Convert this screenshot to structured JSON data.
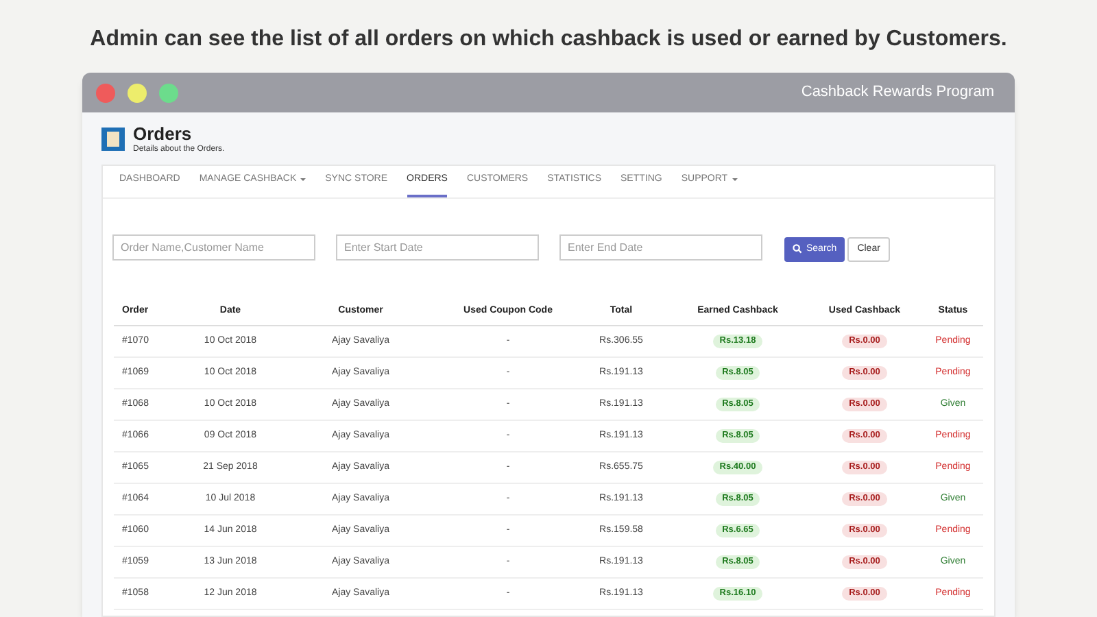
{
  "caption": "Admin can see the list of all orders on which cashback is used or earned by Customers.",
  "window": {
    "title": "Cashback Rewards Program"
  },
  "page": {
    "title": "Orders",
    "subtitle": "Details about the Orders."
  },
  "tabs": [
    {
      "label": "DASHBOARD",
      "selected": false,
      "has_menu": false
    },
    {
      "label": "MANAGE CASHBACK",
      "selected": false,
      "has_menu": true
    },
    {
      "label": "SYNC STORE",
      "selected": false,
      "has_menu": false
    },
    {
      "label": "ORDERS",
      "selected": true,
      "has_menu": false
    },
    {
      "label": "CUSTOMERS",
      "selected": false,
      "has_menu": false
    },
    {
      "label": "STATISTICS",
      "selected": false,
      "has_menu": false
    },
    {
      "label": "SETTING",
      "selected": false,
      "has_menu": false
    },
    {
      "label": "SUPPORT",
      "selected": false,
      "has_menu": true
    }
  ],
  "filters": [
    {
      "placeholder": "Order Name,Customer Name"
    },
    {
      "placeholder": "Enter Start Date"
    },
    {
      "placeholder": "Enter End Date"
    }
  ],
  "buttons": {
    "search": "Search",
    "clear": "Clear"
  },
  "table": {
    "columns": [
      "Order",
      "Date",
      "Customer",
      "Used Coupon Code",
      "Total",
      "Earned Cashback",
      "Used Cashback",
      "Status"
    ],
    "rows": [
      {
        "order": "#1070",
        "date": "10 Oct 2018",
        "customer": "Ajay Savaliya",
        "coupon": "-",
        "total": "Rs.306.55",
        "earned": "Rs.13.18",
        "used": "Rs.0.00",
        "status": "Pending",
        "kind": "pending"
      },
      {
        "order": "#1069",
        "date": "10 Oct 2018",
        "customer": "Ajay Savaliya",
        "coupon": "-",
        "total": "Rs.191.13",
        "earned": "Rs.8.05",
        "used": "Rs.0.00",
        "status": "Pending",
        "kind": "pending"
      },
      {
        "order": "#1068",
        "date": "10 Oct 2018",
        "customer": "Ajay Savaliya",
        "coupon": "-",
        "total": "Rs.191.13",
        "earned": "Rs.8.05",
        "used": "Rs.0.00",
        "status": "Given",
        "kind": "given"
      },
      {
        "order": "#1066",
        "date": "09 Oct 2018",
        "customer": "Ajay Savaliya",
        "coupon": "-",
        "total": "Rs.191.13",
        "earned": "Rs.8.05",
        "used": "Rs.0.00",
        "status": "Pending",
        "kind": "pending"
      },
      {
        "order": "#1065",
        "date": "21 Sep 2018",
        "customer": "Ajay Savaliya",
        "coupon": "-",
        "total": "Rs.655.75",
        "earned": "Rs.40.00",
        "used": "Rs.0.00",
        "status": "Pending",
        "kind": "pending"
      },
      {
        "order": "#1064",
        "date": "10 Jul 2018",
        "customer": "Ajay Savaliya",
        "coupon": "-",
        "total": "Rs.191.13",
        "earned": "Rs.8.05",
        "used": "Rs.0.00",
        "status": "Given",
        "kind": "given"
      },
      {
        "order": "#1060",
        "date": "14 Jun 2018",
        "customer": "Ajay Savaliya",
        "coupon": "-",
        "total": "Rs.159.58",
        "earned": "Rs.6.65",
        "used": "Rs.0.00",
        "status": "Pending",
        "kind": "pending"
      },
      {
        "order": "#1059",
        "date": "13 Jun 2018",
        "customer": "Ajay Savaliya",
        "coupon": "-",
        "total": "Rs.191.13",
        "earned": "Rs.8.05",
        "used": "Rs.0.00",
        "status": "Given",
        "kind": "given"
      },
      {
        "order": "#1058",
        "date": "12 Jun 2018",
        "customer": "Ajay Savaliya",
        "coupon": "-",
        "total": "Rs.191.13",
        "earned": "Rs.16.10",
        "used": "Rs.0.00",
        "status": "Pending",
        "kind": "pending"
      }
    ]
  }
}
